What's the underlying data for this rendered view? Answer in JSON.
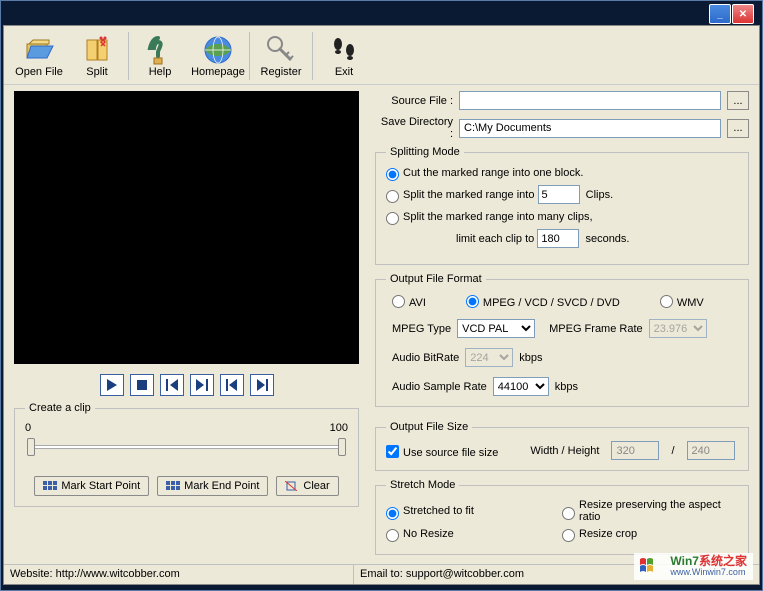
{
  "toolbar": {
    "open_file": "Open File",
    "split": "Split",
    "help": "Help",
    "homepage": "Homepage",
    "register": "Register",
    "exit": "Exit"
  },
  "source_file": {
    "label": "Source File :",
    "value": ""
  },
  "save_dir": {
    "label": "Save Directory :",
    "value": "C:\\My Documents"
  },
  "splitting_mode": {
    "legend": "Splitting Mode",
    "opt_block": "Cut the marked range into one block.",
    "opt_clips_prefix": "Split the marked range into",
    "opt_clips_value": "5",
    "opt_clips_suffix": "Clips.",
    "opt_many_prefix": "Split the marked range into many clips,",
    "opt_many_limit_prefix": "limit each clip to",
    "opt_many_limit_value": "180",
    "opt_many_limit_suffix": "seconds."
  },
  "output_format": {
    "legend": "Output File Format",
    "avi": "AVI",
    "mpeg": "MPEG / VCD / SVCD / DVD",
    "wmv": "WMV",
    "mpeg_type_label": "MPEG Type",
    "mpeg_type_value": "VCD PAL",
    "frame_rate_label": "MPEG Frame Rate",
    "frame_rate_value": "23.976",
    "audio_bitrate_label": "Audio BitRate",
    "audio_bitrate_value": "224",
    "audio_bitrate_unit": "kbps",
    "sample_rate_label": "Audio Sample Rate",
    "sample_rate_value": "44100",
    "sample_rate_unit": "kbps"
  },
  "output_size": {
    "legend": "Output File Size",
    "use_source": "Use source file size",
    "wh_label": "Width / Height",
    "width": "320",
    "slash": "/",
    "height": "240"
  },
  "stretch": {
    "legend": "Stretch Mode",
    "fit": "Stretched to fit",
    "preserve": "Resize preserving the aspect ratio",
    "noresize": "No Resize",
    "crop": "Resize crop"
  },
  "clip": {
    "legend": "Create a clip",
    "start": "0",
    "end": "100",
    "mark_start": "Mark Start Point",
    "mark_end": "Mark End Point",
    "clear": "Clear"
  },
  "status": {
    "website": "Website: http://www.witcobber.com",
    "email": "Email to: support@witcobber.com"
  },
  "watermark": {
    "cn": "系统之家",
    "prefix": "Win7",
    "url": "www.Winwin7.com"
  }
}
